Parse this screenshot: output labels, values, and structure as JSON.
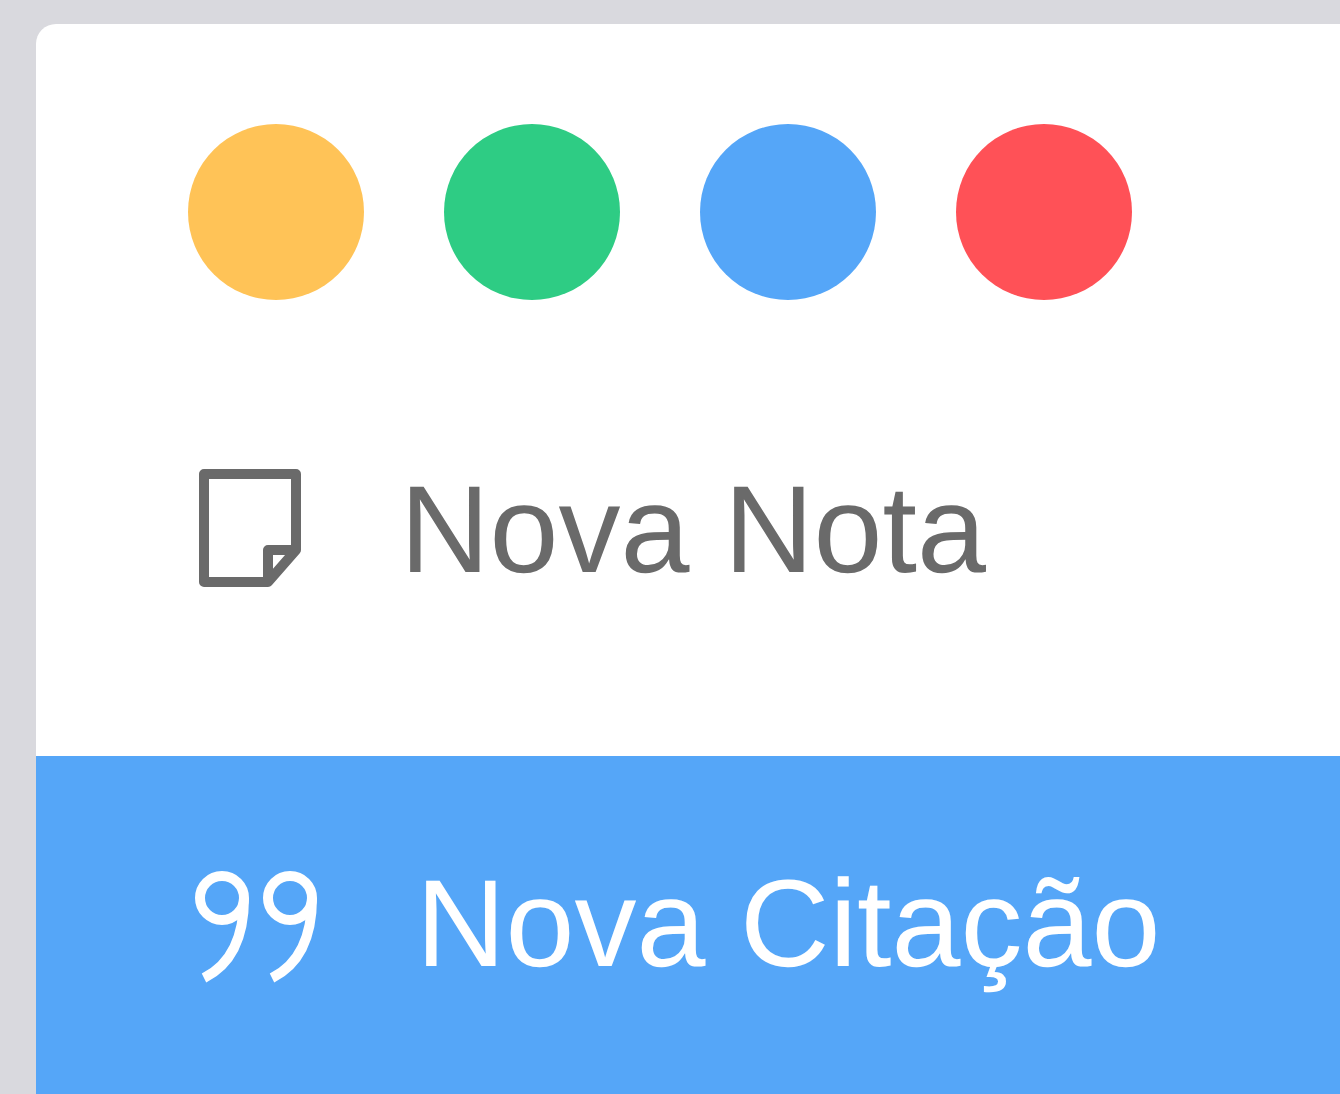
{
  "colors": [
    {
      "color": "#ffc357"
    },
    {
      "color": "#2ecc84"
    },
    {
      "color": "#55a6f8"
    },
    {
      "color": "#ff5157"
    }
  ],
  "items": [
    {
      "kind": "note",
      "label": "Nova Nota",
      "selected": false
    },
    {
      "kind": "quote",
      "label": "Nova Citação",
      "selected": true
    }
  ]
}
